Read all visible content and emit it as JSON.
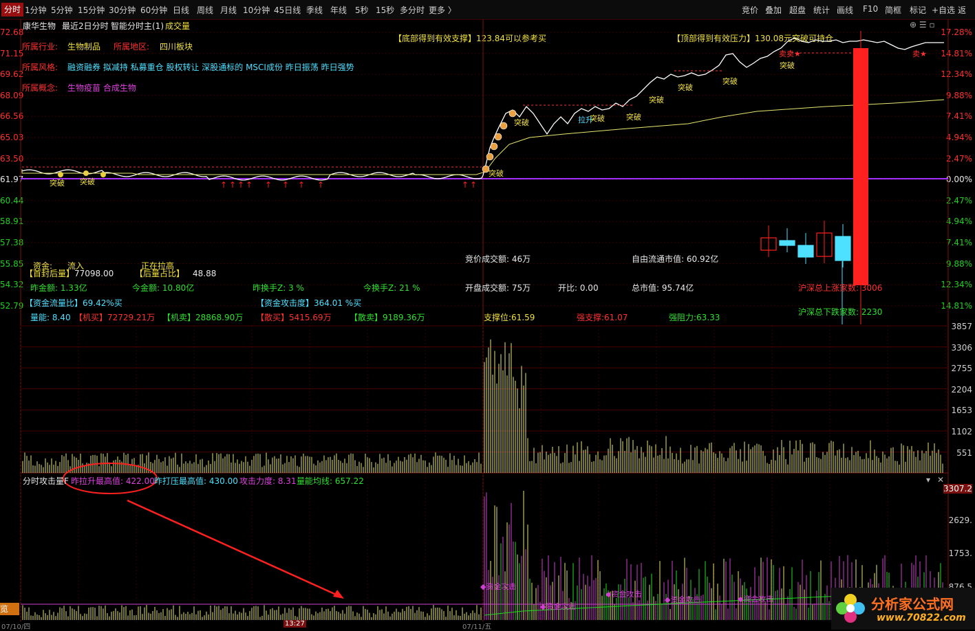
{
  "toolbar": {
    "left_items": [
      "分时",
      "1分钟",
      "5分钟",
      "15分钟",
      "30分钟",
      "60分钟",
      "日线",
      "周线",
      "月线",
      "10分钟",
      "45日线",
      "季线",
      "年线",
      "5秒",
      "15秒",
      "多分时",
      "更多 〉"
    ],
    "right_items": [
      "竞价",
      "叠加",
      "超盘",
      "统计",
      "画线",
      "F10",
      "简框",
      "标记",
      "+自选",
      "返"
    ]
  },
  "header": {
    "stock_name": "康华生物",
    "period": "最近2日分时",
    "indicator": "智能分时主(1)",
    "volume_label": "成交量"
  },
  "info": {
    "industry_label": "所属行业:",
    "industry_value": "生物制品",
    "region_label": "所属地区:",
    "region_value": "四川板块",
    "style_label": "所属风格:",
    "style_value": "融资融券 拟减持 私募重仓 股权转让 深股通标的 MSCI成份 昨日振荡 昨日强势",
    "concept_label": "所属概念:",
    "concept_value": "生物疫苗 合成生物",
    "support_text": "【底部得到有效支撑】123.84可以参考买",
    "pressure_text": "【顶部得到有效压力】130.08元突破可持仓"
  },
  "left_axis": [
    "72.68",
    "71.15",
    "69.62",
    "68.09",
    "66.56",
    "65.03",
    "63.50",
    "61.97",
    "60.44",
    "58.91",
    "57.38",
    "55.85",
    "54.32",
    "52.79"
  ],
  "right_axis": [
    "17.28%",
    "14.81%",
    "12.34%",
    "9.88%",
    "7.41%",
    "4.94%",
    "2.47%",
    "0.00%",
    "2.47%",
    "4.94%",
    "7.41%",
    "9.88%",
    "12.34%",
    "14.81%"
  ],
  "vol_axis": [
    "3857",
    "3306",
    "2755",
    "2204",
    "1653",
    "1102",
    "551"
  ],
  "attack_axis": [
    "3307.2",
    "2629.",
    "1753.",
    "876.5"
  ],
  "stats": {
    "fund_label": "资金:",
    "fund_value": "流入",
    "pulling_text": "正在拉高",
    "first_seal_label": "【首封后量】",
    "first_seal_value": "77098.00",
    "later_ratio_label": "【后量占比】",
    "later_ratio_value": "48.88",
    "yest_amount": "昨金额: 1.33亿",
    "today_amount": "今金额: 10.80亿",
    "yest_turnover": "昨换手Z:  3   %",
    "today_turnover": "今换手Z:  21   %",
    "flow_ratio": "【资金流量比】69.42%买",
    "attack_degree": "【资金攻击度】364.01 %买",
    "vol_energy": "量能: 8.40",
    "inst_buy": "【机买】72729.21万",
    "inst_sell": "【机卖】28868.90万",
    "retail_buy": "【散买】5415.69万",
    "retail_sell": "【散卖】9189.36万",
    "auction_amount": "竞价成交额: 46万",
    "open_amount": "开盘成交额: 75万",
    "open_ratio": "开比: 0.00",
    "float_cap": "自由流通市值: 60.92亿",
    "total_cap": "总市值: 95.74亿",
    "support_level": "支撑位:61.59",
    "strong_support": "强支撑:61.07",
    "strong_resist": "强阻力:63.33",
    "up_count": "沪深总上涨家数: 3006",
    "down_count": "沪深总下跌家数: 2230"
  },
  "attack_panel": {
    "title": "分时攻击量F",
    "pull_max": "昨拉升最高值: 422.00",
    "press_max": "昨打压最高值: 430.00",
    "attack_force": "攻击力度: 8.31",
    "avg_line": "量能均线: 657.22"
  },
  "markers": {
    "breakout": "突破",
    "pull": "拉升",
    "sell": "卖",
    "fund_attack": "资金攻击"
  },
  "time_labels": {
    "t1": "07/10/四",
    "t2": "13:27",
    "t3": "07/11/五"
  },
  "side_tab": "览",
  "logo": {
    "line1": "分析家公式网",
    "line2": "www.70822.com"
  },
  "colors": {
    "up": "#ff2020",
    "down": "#20e020",
    "price_line": "#ffffff",
    "avg_line": "#e8e870",
    "accent": "#9a1010"
  }
}
